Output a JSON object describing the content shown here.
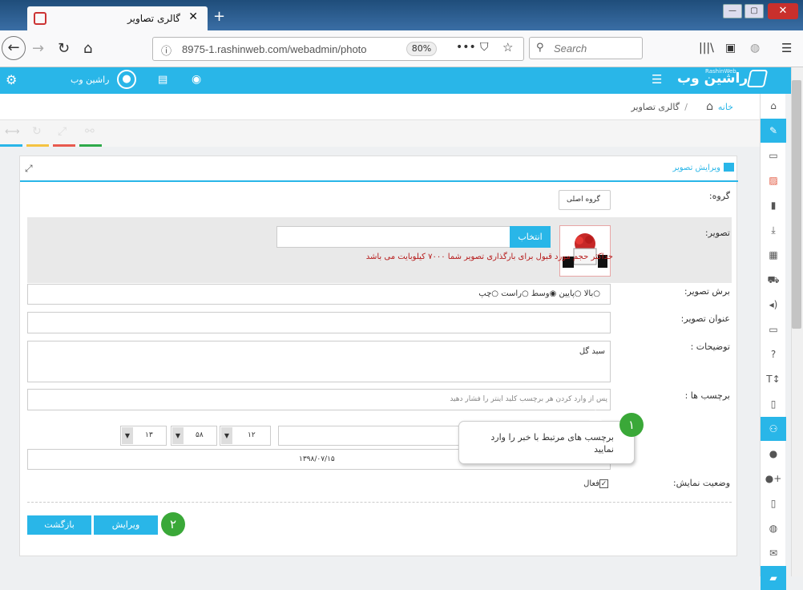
{
  "browser": {
    "tab_title": "گالری تصاویر",
    "tab_close": "✕",
    "new_tab": "+",
    "url": "8975-1.rashinweb.com/webadmin/photo",
    "zoom": "80%",
    "search_placeholder": "Search"
  },
  "app": {
    "logo": "راشین وب",
    "logo_sub": "RashinWeb",
    "user": "راشین وب"
  },
  "breadcrumb": {
    "home": "خانه",
    "sep": "/",
    "current": "گالری تصاویر"
  },
  "panel": {
    "title": "ویرایش تصویر"
  },
  "form": {
    "group_label": "گروه:",
    "group_value": "گروه اصلی",
    "image_label": "تصویر:",
    "choose_button": "انتخاب",
    "size_note": "حداکثر حجم مورد قبول برای بارگذاری تصویر شما ۷۰۰۰ کیلوبایت می باشد",
    "crop_label": "برش تصویر:",
    "crop_options": [
      "بالا",
      "پایین",
      "وسط",
      "راست",
      "چپ"
    ],
    "title_label": "عنوان تصویر:",
    "desc_label": "توضیحات :",
    "desc_value": "سبد گل",
    "tags_label": "برچسب ها :",
    "tags_placeholder": "پس از وارد کردن هر برچسب کلید اینتر را فشار دهید",
    "time": {
      "hour": "۱۲",
      "minute": "۵۸",
      "second": "۱۳"
    },
    "date_value": "۱۳۹۸/۰۷/۱۵",
    "status_label": "وضعیت نمایش:",
    "status_value": "فعال",
    "edit_button": "ویرایش",
    "back_button": "بازگشت"
  },
  "callouts": {
    "one_num": "۱",
    "one_text": "برچسب های مرتبط با خبر را وارد نمایید",
    "two_num": "۲"
  },
  "colors": {
    "accent": "#29b6e8",
    "callout_green": "#3aa838",
    "warning_text": "#b71c1c"
  }
}
